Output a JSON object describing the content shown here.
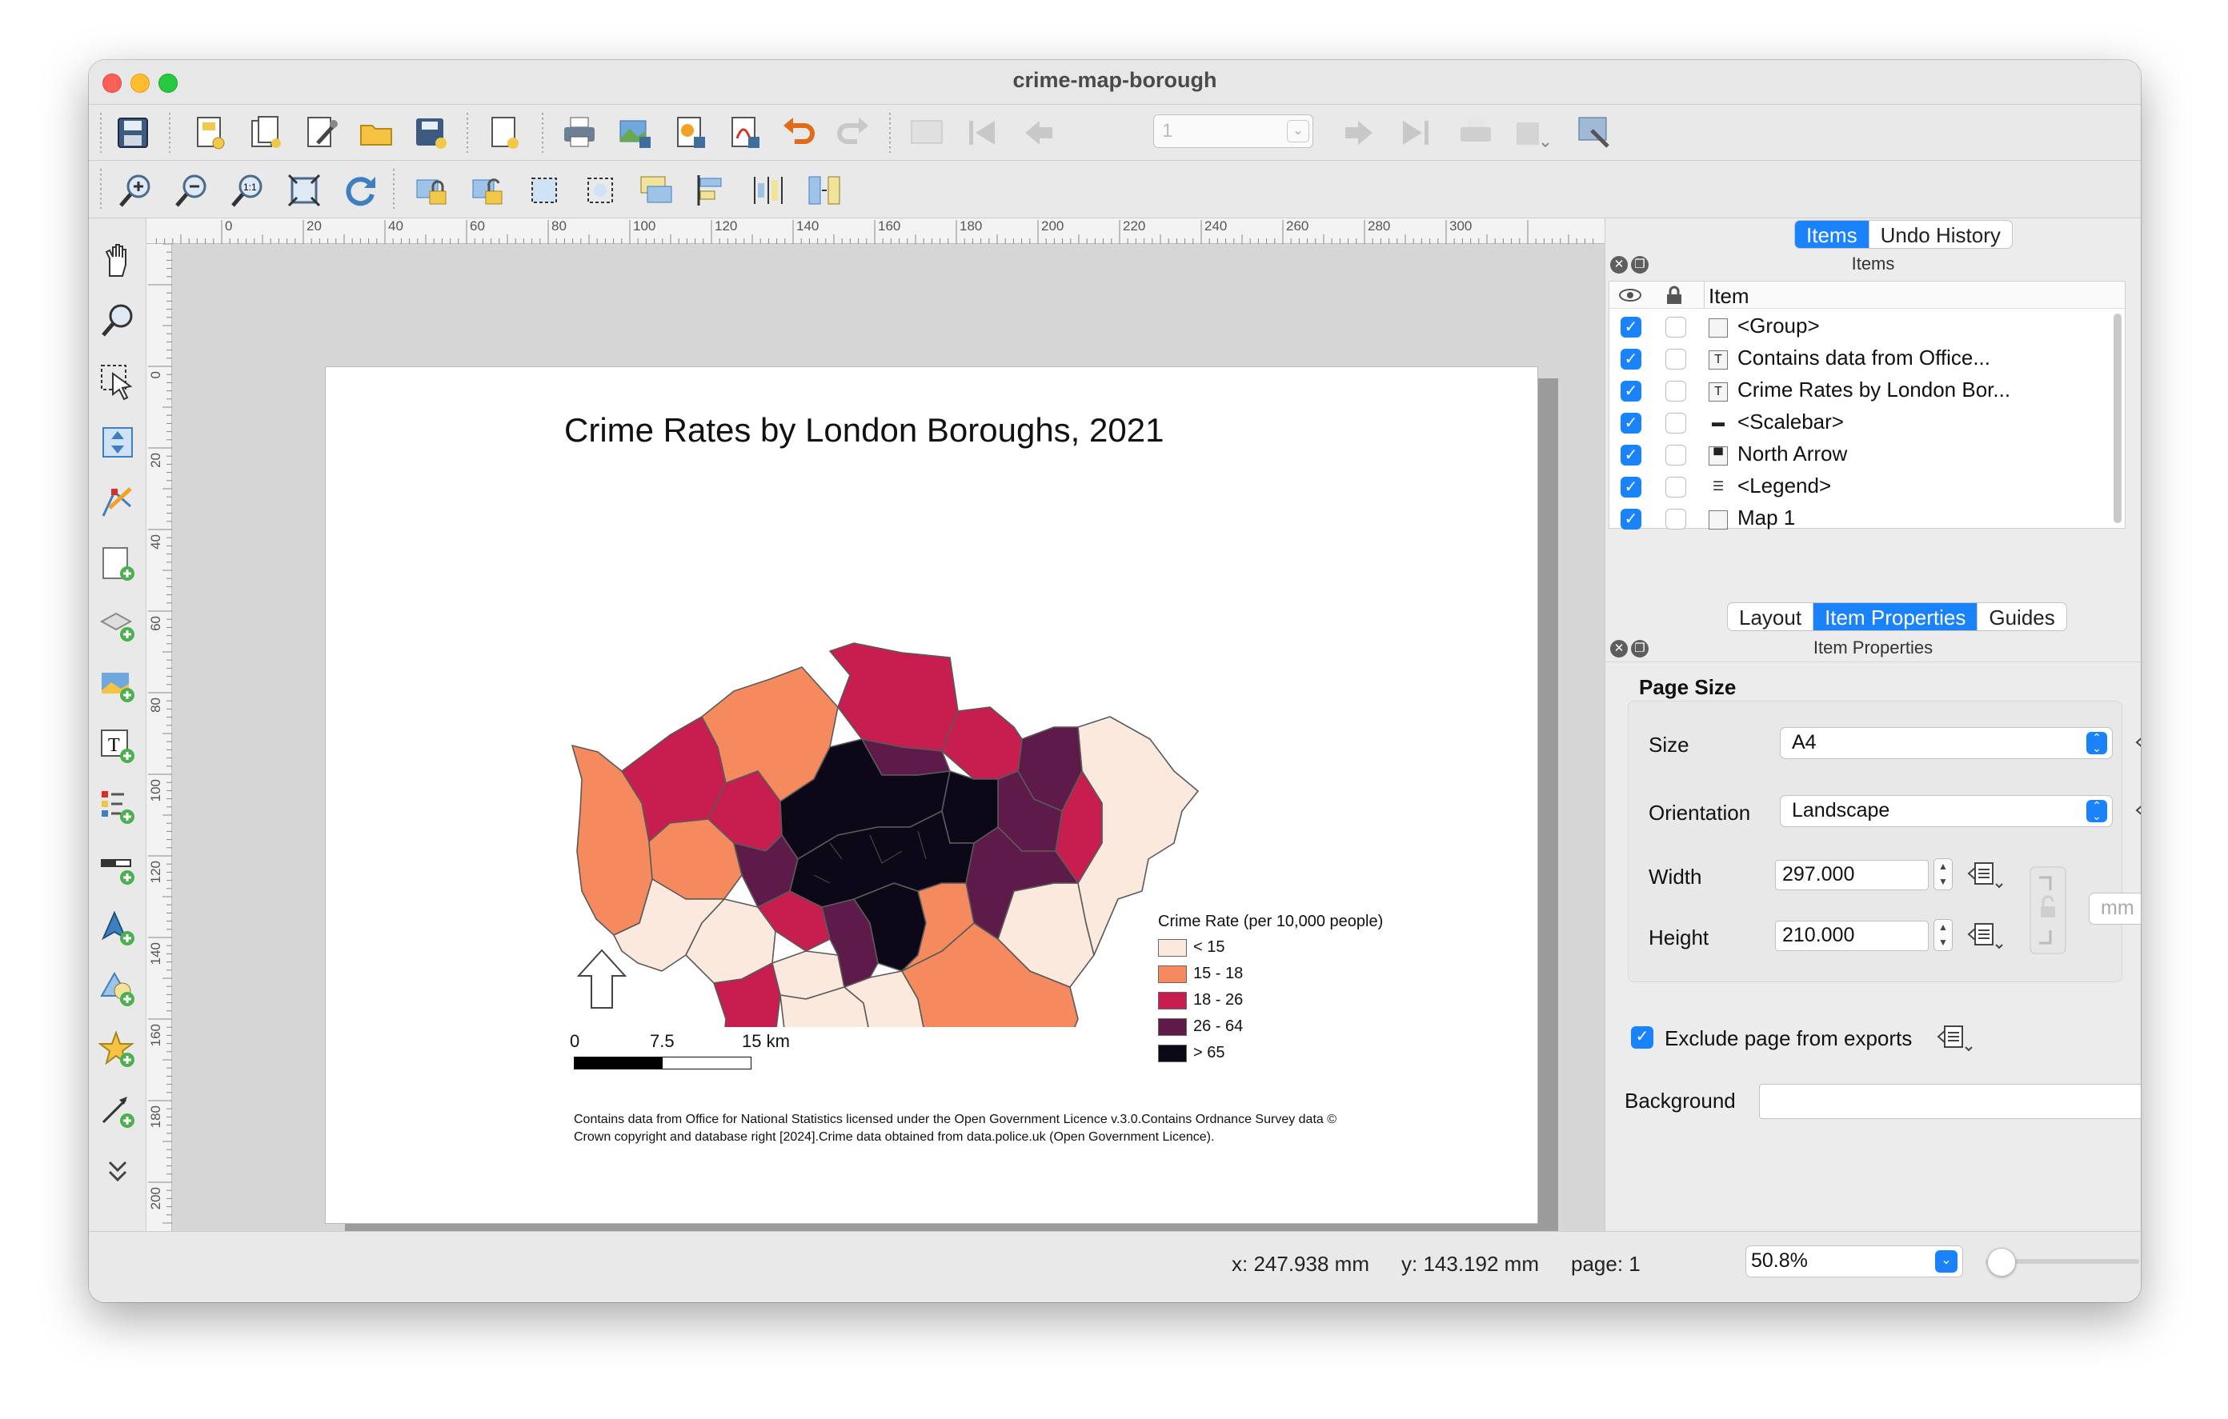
{
  "window": {
    "title": "crime-map-borough"
  },
  "toolbar": {
    "page_number": "1",
    "icons_row1": [
      "save-icon",
      "new-layout-icon",
      "duplicate-layout-icon",
      "layout-manager-icon",
      "open-template-icon",
      "save-template-icon",
      "new-report-icon",
      "print-icon",
      "export-image-icon",
      "export-svg-icon",
      "export-pdf-icon",
      "undo-icon",
      "redo-icon",
      "atlas-preview-icon",
      "atlas-first-icon",
      "atlas-previous-icon",
      "atlas-next-icon",
      "atlas-last-icon",
      "atlas-print-icon",
      "atlas-export-icon",
      "atlas-settings-icon"
    ],
    "icons_row2": [
      "zoom-in-icon",
      "zoom-out-icon",
      "zoom-actual-icon",
      "zoom-full-icon",
      "refresh-icon",
      "lock-items-icon",
      "unlock-items-icon",
      "select-all-icon",
      "deselect-icon",
      "raise-items-icon",
      "align-icon",
      "distribute-icon",
      "resize-icon"
    ]
  },
  "left_tools": [
    "pan-icon",
    "zoom-tool-icon",
    "select-move-icon",
    "move-content-icon",
    "edit-nodes-icon",
    "add-map-icon",
    "add-3d-map-icon",
    "add-picture-icon",
    "add-label-icon",
    "add-legend-icon",
    "add-scalebar-icon",
    "add-north-arrow-icon",
    "add-shape-icon",
    "add-marker-icon",
    "add-arrow-icon",
    "more-tools-icon"
  ],
  "ruler": {
    "top_ticks": [
      "0",
      "20",
      "40",
      "60",
      "80",
      "100",
      "120",
      "140",
      "160",
      "180",
      "200",
      "220",
      "240",
      "260",
      "280",
      "300"
    ],
    "left_ticks": [
      "0",
      "20",
      "40",
      "60",
      "80",
      "100",
      "120",
      "140",
      "160",
      "180",
      "200"
    ]
  },
  "map": {
    "title": "Crime Rates by London Boroughs, 2021",
    "legend_title": "Crime Rate (per 10,000 people)",
    "legend": [
      {
        "label": "< 15",
        "color": "#fbe9dd"
      },
      {
        "label": "15 - 18",
        "color": "#f58a5e"
      },
      {
        "label": "18 - 26",
        "color": "#c71e4f"
      },
      {
        "label": "26 - 64",
        "color": "#5e1b49"
      },
      {
        "label": "> 65",
        "color": "#0c0818"
      }
    ],
    "scale": {
      "zero": "0",
      "mid": "7.5",
      "end": "15 km"
    },
    "attribution_1": "Contains data from Office for National Statistics licensed under the Open Government Licence v.3.0.Contains Ordnance Survey data ©",
    "attribution_2": "Crown copyright and database right [2024].Crime data obtained from data.police.uk (Open Government Licence)."
  },
  "panel": {
    "top_tabs": [
      "Items",
      "Undo History"
    ],
    "items_header": "Items",
    "items_col": "Item",
    "items": [
      {
        "name": "<Group>",
        "type": "group-icon"
      },
      {
        "name": "Contains data from Office...",
        "type": "label-item-icon"
      },
      {
        "name": "Crime Rates by London Bor...",
        "type": "label-item-icon"
      },
      {
        "name": "<Scalebar>",
        "type": "scalebar-item-icon"
      },
      {
        "name": "North Arrow",
        "type": "picture-item-icon"
      },
      {
        "name": "<Legend>",
        "type": "legend-item-icon"
      },
      {
        "name": "Map 1",
        "type": "map-item-icon"
      }
    ],
    "bottom_tabs": [
      "Layout",
      "Item Properties",
      "Guides"
    ],
    "props_header": "Item Properties",
    "page_size_title": "Page Size",
    "size_label": "Size",
    "size_value": "A4",
    "orientation_label": "Orientation",
    "orientation_value": "Landscape",
    "width_label": "Width",
    "width_value": "297.000",
    "height_label": "Height",
    "height_value": "210.000",
    "unit": "mm",
    "exclude_label": "Exclude page from exports",
    "background_label": "Background"
  },
  "status": {
    "x": "x: 247.938 mm",
    "y": "y: 143.192 mm",
    "page": "page: 1",
    "zoom": "50.8%"
  }
}
